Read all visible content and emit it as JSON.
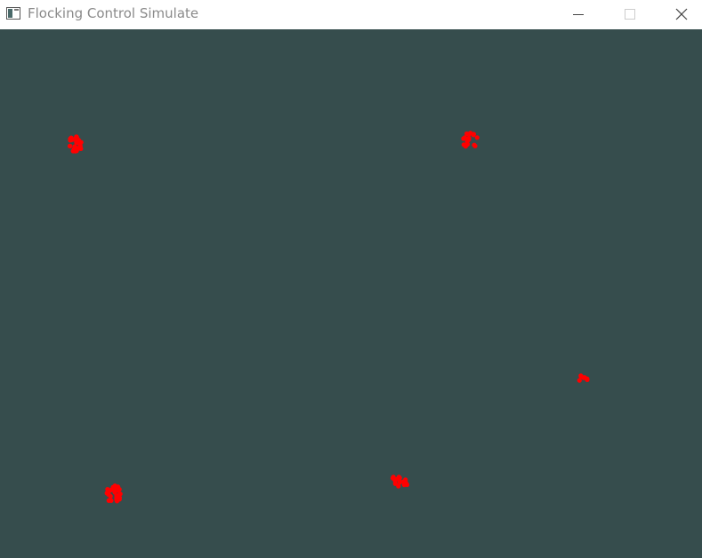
{
  "window": {
    "title": "Flocking Control Simulate",
    "controls": {
      "minimize": "minimize",
      "maximize": "maximize",
      "close": "close"
    }
  },
  "canvas": {
    "background_color": "#364d4d",
    "agent_color": "#ff0000"
  }
}
